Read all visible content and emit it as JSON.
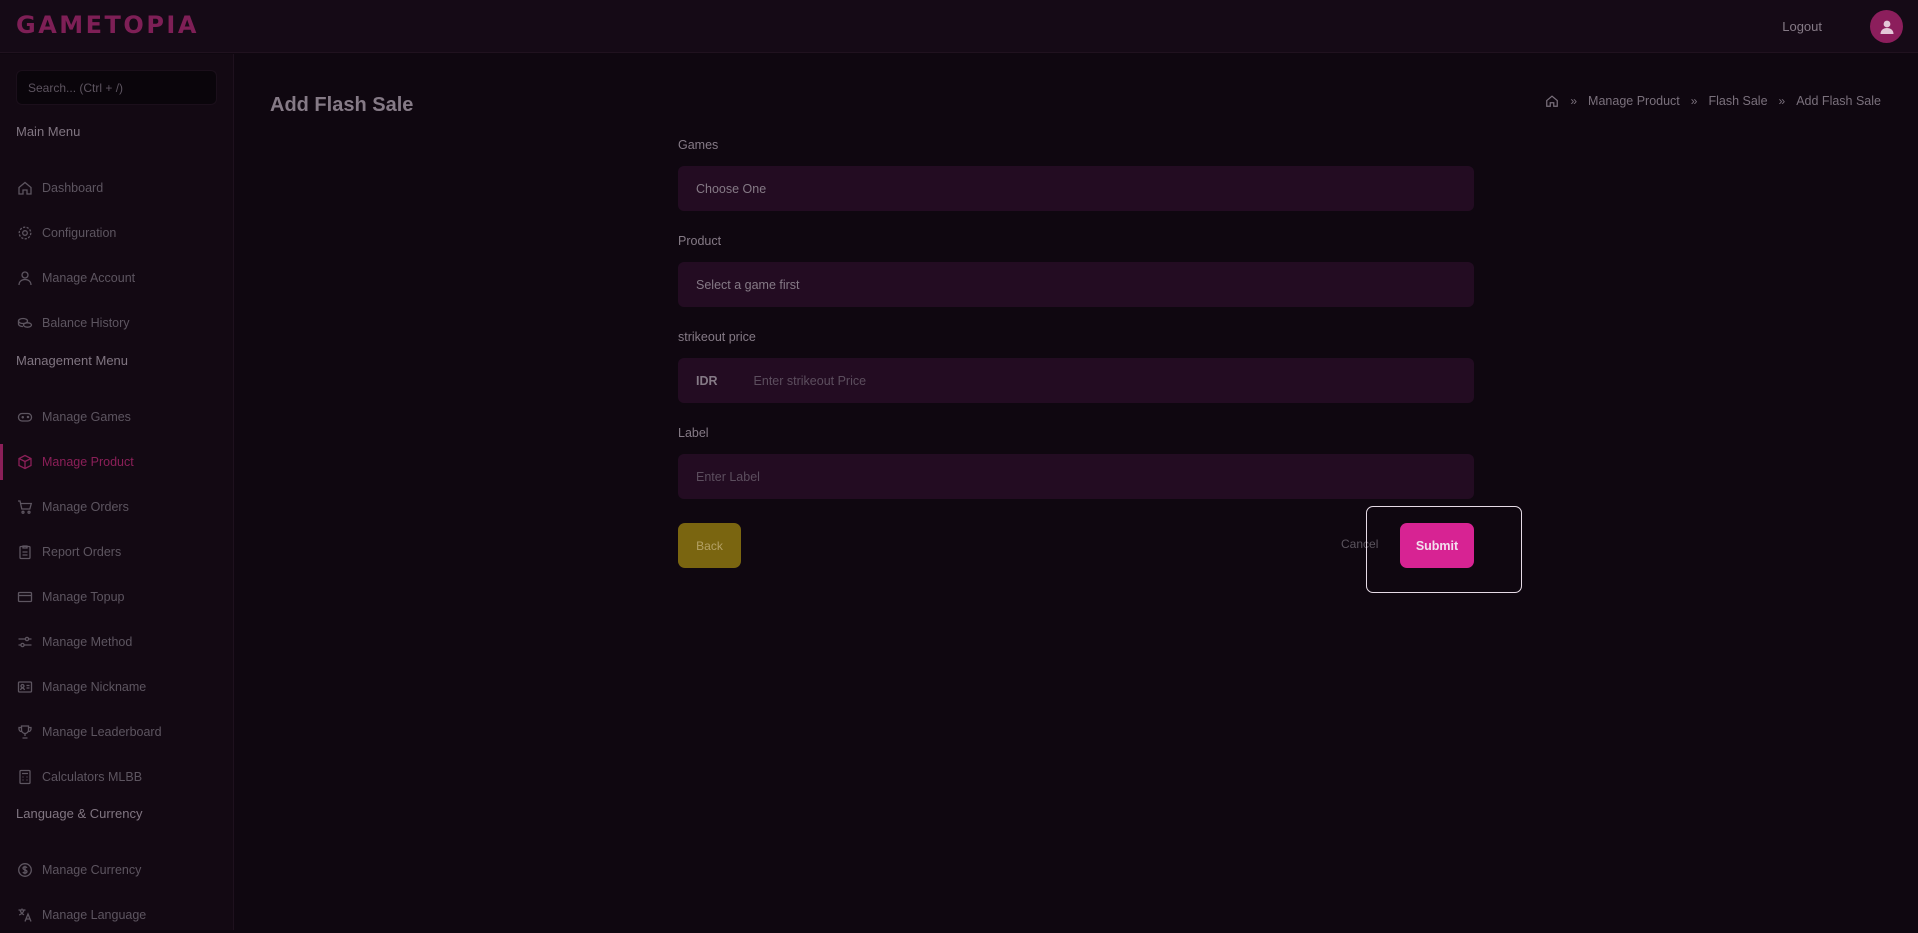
{
  "app": {
    "logo": "GAMETOPIA",
    "logout": "Logout"
  },
  "sidebar": {
    "search_placeholder": "Search... (Ctrl + /)",
    "sections": [
      {
        "title": "Main Menu"
      },
      {
        "title": "Management Menu"
      },
      {
        "title": "Language & Currency"
      }
    ],
    "items": [
      {
        "label": "Dashboard",
        "icon": "home-icon"
      },
      {
        "label": "Configuration",
        "icon": "gear-icon"
      },
      {
        "label": "Manage Account",
        "icon": "user-icon"
      },
      {
        "label": "Balance History",
        "icon": "coins-icon"
      },
      {
        "label": "Manage Games",
        "icon": "gamepad-icon"
      },
      {
        "label": "Manage Product",
        "icon": "box-icon",
        "active": true
      },
      {
        "label": "Manage Orders",
        "icon": "cart-icon"
      },
      {
        "label": "Report Orders",
        "icon": "clipboard-icon"
      },
      {
        "label": "Manage Topup",
        "icon": "card-icon"
      },
      {
        "label": "Manage Method",
        "icon": "sliders-icon"
      },
      {
        "label": "Manage Nickname",
        "icon": "id-card-icon"
      },
      {
        "label": "Manage Leaderboard",
        "icon": "trophy-icon"
      },
      {
        "label": "Calculators MLBB",
        "icon": "calculator-icon"
      },
      {
        "label": "Manage Currency",
        "icon": "dollar-icon"
      },
      {
        "label": "Manage Language",
        "icon": "translate-icon"
      }
    ]
  },
  "page": {
    "title": "Add Flash Sale",
    "breadcrumb": [
      "Manage Product",
      "Flash Sale",
      "Add Flash Sale"
    ]
  },
  "form": {
    "games": {
      "label": "Games",
      "value": "Choose One"
    },
    "product": {
      "label": "Product",
      "value": "Select a game first"
    },
    "strikeout": {
      "label": "strikeout price",
      "prefix": "IDR",
      "placeholder": "Enter strikeout Price"
    },
    "label_field": {
      "label": "Label",
      "placeholder": "Enter Label"
    }
  },
  "buttons": {
    "back": "Back",
    "cancel": "Cancel",
    "submit": "Submit"
  },
  "colors": {
    "accent": "#d72393",
    "back": "#7a6510",
    "bg": "#0f0710",
    "field": "#230c22"
  }
}
